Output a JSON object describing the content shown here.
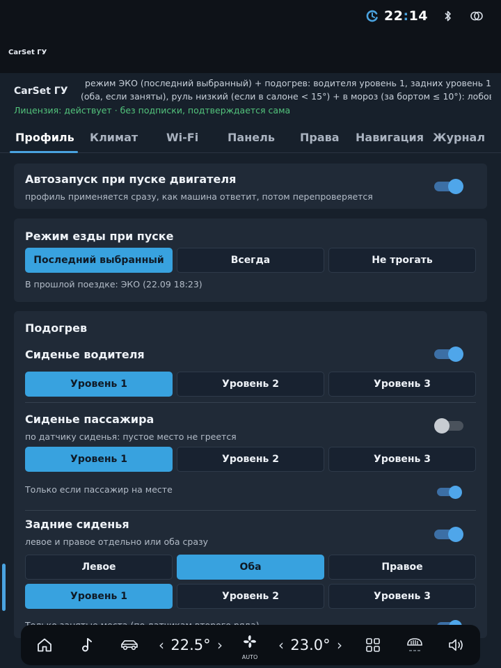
{
  "status": {
    "time_hours": "22",
    "time_sep": ":",
    "time_minutes": "14",
    "clock_icon": "sync-clock-icon",
    "bluetooth_icon": "bluetooth-icon",
    "link_icon": "link-icon",
    "app_name_small": "CarSet ГУ",
    "accent": "#4aa3e0"
  },
  "header": {
    "app_title": "CarSet ГУ",
    "info_line1": "режим ЭКО (последний выбранный) + подогрев: водителя уровень 1, задних уровень 1",
    "info_line2": "(оба, если заняты), руль низкий (если в салоне < 15°) + в мороз (за бортом ≤ 10°): лобовое",
    "license": "Лицензия: действует · без подписки, подтверждается сама",
    "license_color": "#53c47c"
  },
  "tabs": [
    {
      "label": "Профиль",
      "active": true
    },
    {
      "label": "Климат"
    },
    {
      "label": "Wi-Fi"
    },
    {
      "label": "Панель"
    },
    {
      "label": "Права"
    },
    {
      "label": "Навигация"
    },
    {
      "label": "Журнал"
    }
  ],
  "autostart": {
    "title": "Автозапуск при пуске двигателя",
    "subtitle": "профиль применяется сразу, как машина ответит, потом перепроверяется",
    "enabled": true
  },
  "drive_mode": {
    "title": "Режим езды при пуске",
    "options": [
      "Последний выбранный",
      "Всегда",
      "Не трогать"
    ],
    "selected": "Последний выбранный",
    "last_trip": "В прошлой поездке: ЭКО (22.09 18:23)"
  },
  "heating": {
    "title": "Подогрев",
    "driver_seat": {
      "title": "Сиденье водителя",
      "enabled": true,
      "levels": [
        "Уровень 1",
        "Уровень 2",
        "Уровень 3"
      ],
      "selected": "Уровень 1"
    },
    "passenger_seat": {
      "title": "Сиденье пассажира",
      "subtitle": "по датчику сиденья: пустое место не греется",
      "enabled": false,
      "levels": [
        "Уровень 1",
        "Уровень 2",
        "Уровень 3"
      ],
      "selected": "Уровень 1",
      "only_if_present": "Только если пассажир на месте",
      "only_if_present_enabled": true
    },
    "rear_seats": {
      "title": "Задние сиденья",
      "subtitle": "левое и правое отдельно или оба сразу",
      "enabled": true,
      "sides": [
        "Левое",
        "Оба",
        "Правое"
      ],
      "selected_side": "Оба",
      "levels": [
        "Уровень 1",
        "Уровень 2",
        "Уровень 3"
      ],
      "selected": "Уровень 1",
      "only_occupied": "Только занятые места (по датчикам второго ряда)",
      "only_occupied_enabled": true
    }
  },
  "dock": {
    "home_icon": "home-icon",
    "music_icon": "music-note-icon",
    "car_icon": "car-icon",
    "left_temp": "22.5°",
    "fan_icon": "fan-icon",
    "fan_label": "AUTO",
    "right_temp": "23.0°",
    "left_arrow": "‹",
    "right_arrow": "›",
    "apps_icon": "apps-grid-icon",
    "defrost_icon": "rear-defrost-icon",
    "volume_icon": "volume-icon"
  }
}
